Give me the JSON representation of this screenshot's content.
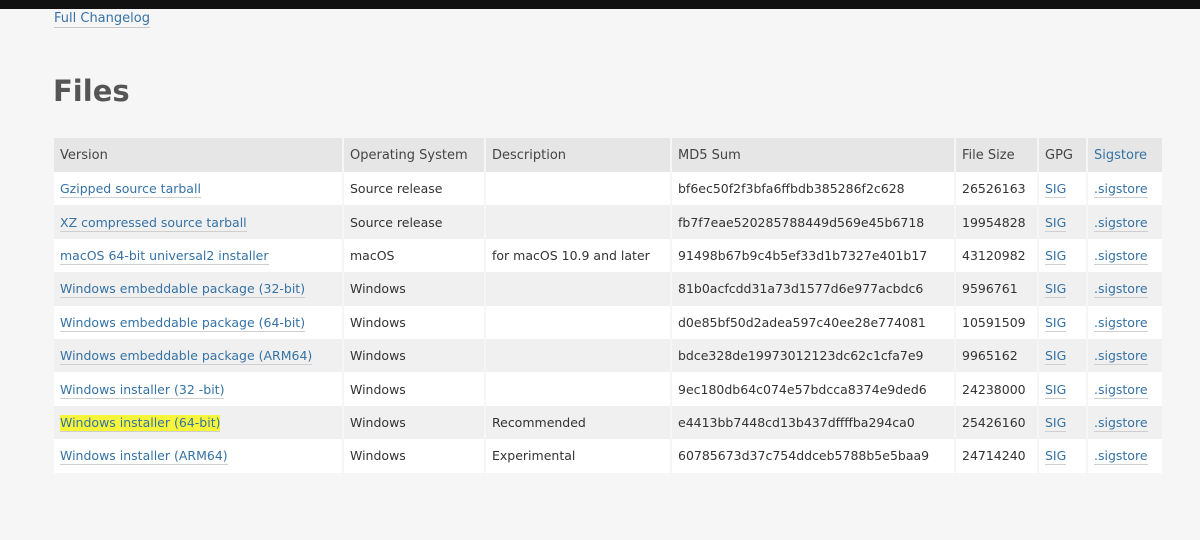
{
  "changelog_link": "Full Changelog",
  "heading": "Files",
  "table": {
    "headers": [
      "Version",
      "Operating System",
      "Description",
      "MD5 Sum",
      "File Size",
      "GPG",
      "Sigstore"
    ],
    "rows": [
      {
        "version": "Gzipped source tarball",
        "os": "Source release",
        "description": "",
        "md5": "bf6ec50f2f3bfa6ffbdb385286f2c628",
        "size": "26526163",
        "gpg": "SIG",
        "sigstore": ".sigstore"
      },
      {
        "version": "XZ compressed source tarball",
        "os": "Source release",
        "description": "",
        "md5": "fb7f7eae520285788449d569e45b6718",
        "size": "19954828",
        "gpg": "SIG",
        "sigstore": ".sigstore"
      },
      {
        "version": "macOS 64-bit universal2 installer",
        "os": "macOS",
        "description": "for macOS 10.9 and later",
        "md5": "91498b67b9c4b5ef33d1b7327e401b17",
        "size": "43120982",
        "gpg": "SIG",
        "sigstore": ".sigstore"
      },
      {
        "version": "Windows embeddable package (32-bit)",
        "os": "Windows",
        "description": "",
        "md5": "81b0acfcdd31a73d1577d6e977acbdc6",
        "size": "9596761",
        "gpg": "SIG",
        "sigstore": ".sigstore"
      },
      {
        "version": "Windows embeddable package (64-bit)",
        "os": "Windows",
        "description": "",
        "md5": "d0e85bf50d2adea597c40ee28e774081",
        "size": "10591509",
        "gpg": "SIG",
        "sigstore": ".sigstore"
      },
      {
        "version": "Windows embeddable package (ARM64)",
        "os": "Windows",
        "description": "",
        "md5": "bdce328de19973012123dc62c1cfa7e9",
        "size": "9965162",
        "gpg": "SIG",
        "sigstore": ".sigstore"
      },
      {
        "version": "Windows installer (32 -bit)",
        "os": "Windows",
        "description": "",
        "md5": "9ec180db64c074e57bdcca8374e9ded6",
        "size": "24238000",
        "gpg": "SIG",
        "sigstore": ".sigstore"
      },
      {
        "version": "Windows installer (64-bit)",
        "os": "Windows",
        "description": "Recommended",
        "md5": "e4413bb7448cd13b437dffffba294ca0",
        "size": "25426160",
        "gpg": "SIG",
        "sigstore": ".sigstore",
        "highlighted": true
      },
      {
        "version": "Windows installer (ARM64)",
        "os": "Windows",
        "description": "Experimental",
        "md5": "60785673d37c754ddceb5788b5e5baa9",
        "size": "24714240",
        "gpg": "SIG",
        "sigstore": ".sigstore"
      }
    ]
  },
  "colors": {
    "link": "#3572a5",
    "highlight": "#f7f53a",
    "header_bg": "#e6e6e6",
    "page_bg": "#f6f6f6"
  }
}
